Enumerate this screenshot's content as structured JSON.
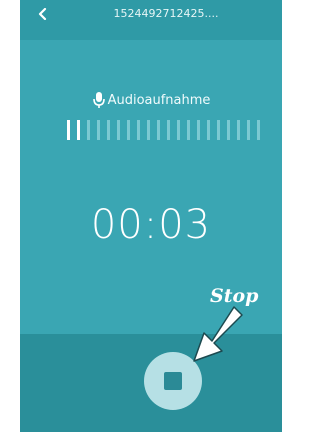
{
  "topbar": {
    "title": "1524492712425....",
    "back_icon": "chevron-left-icon"
  },
  "recording": {
    "label": "Audioaufnahme",
    "mic_icon": "microphone-icon",
    "level_bars_total": 20,
    "level_bars_active": 2,
    "timer": "00:03"
  },
  "controls": {
    "stop_icon": "stop-icon"
  },
  "annotation": {
    "text": "Stop",
    "arrow_icon": "arrow-icon"
  },
  "colors": {
    "main_bg": "#3aa6b3",
    "bottom_bg": "#2a8f9a",
    "stop_button": "#b6e0e5"
  }
}
